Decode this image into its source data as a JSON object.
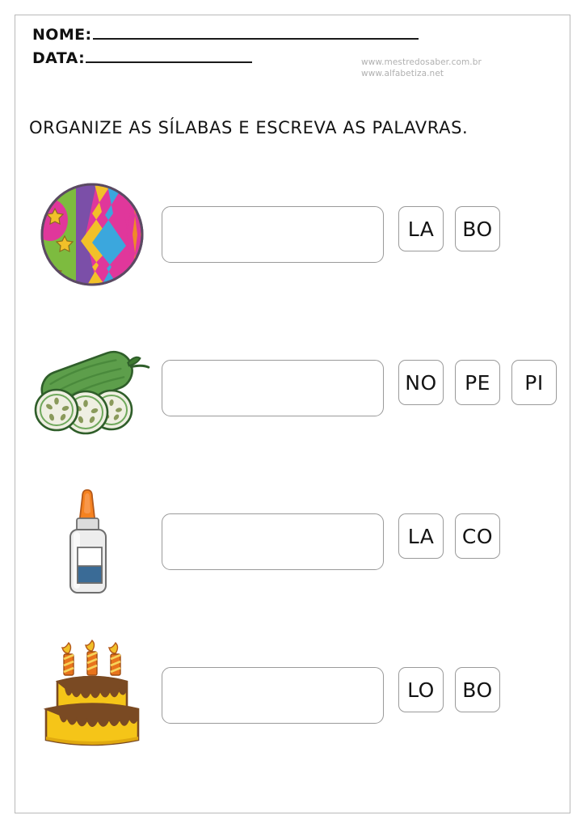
{
  "header": {
    "name_label": "NOME:",
    "date_label": "DATA:",
    "sites": [
      "www.mestredosaber.com.br",
      "www.alfabetiza.net"
    ]
  },
  "instruction": "ORGANIZE AS SÍLABAS E ESCREVA AS PALAVRAS.",
  "exercises": [
    {
      "image": "beach-ball",
      "answer_value": "",
      "tiles": [
        {
          "label": "LA"
        },
        {
          "label": "BO"
        }
      ]
    },
    {
      "image": "cucumber",
      "answer_value": "",
      "tiles": [
        {
          "label": "NO"
        },
        {
          "label": "PE"
        },
        {
          "label": "PI"
        }
      ]
    },
    {
      "image": "glue-bottle",
      "answer_value": "",
      "tiles": [
        {
          "label": "LA"
        },
        {
          "label": "CO"
        }
      ]
    },
    {
      "image": "birthday-cake",
      "answer_value": "",
      "tiles": [
        {
          "label": "LO"
        },
        {
          "label": "BO"
        }
      ]
    }
  ],
  "colors": {
    "page_border": "#b9b9b9",
    "text": "#141414",
    "site_text": "#b0b0b0",
    "box_border": "#9a9a9a",
    "ball_pink": "#E0379B",
    "ball_green": "#7DBB3F",
    "ball_purple": "#7B4FA8",
    "ball_blue": "#3BA7DD",
    "ball_yellow": "#F2C029",
    "ball_orange": "#F08A28",
    "cucumber_body": "#5D9E4B",
    "cucumber_dark": "#2F5E2A",
    "cucumber_flesh": "#EFEFE2",
    "glue_nozzle": "#F58220",
    "glue_body": "#E9E9E9",
    "glue_label_blue": "#3A6B96",
    "cake_yellow": "#F5C518",
    "cake_brown": "#7A4A23",
    "candle_orange": "#E8731C"
  }
}
